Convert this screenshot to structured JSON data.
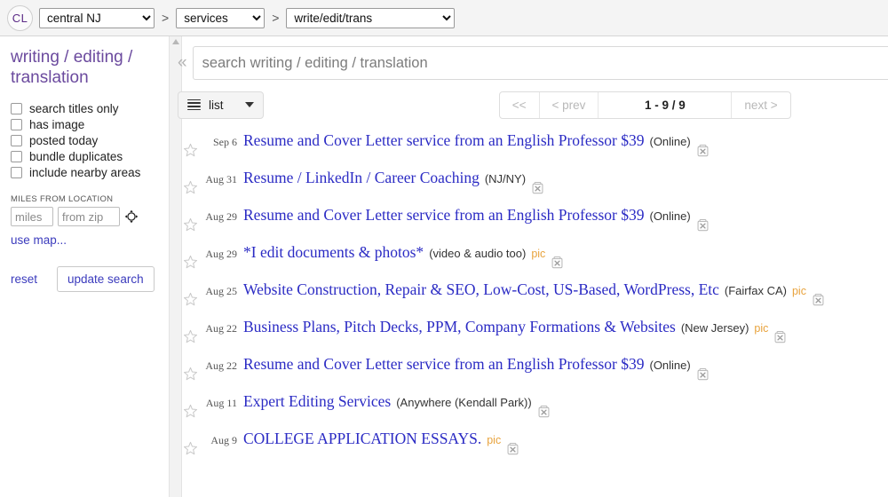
{
  "header": {
    "logo": "CL",
    "logo_icon": "cl-circle-icon",
    "separator": ">",
    "location": "central NJ",
    "category": "services",
    "subcategory": "write/edit/trans"
  },
  "sidebar": {
    "title": "writing / editing / translation",
    "checkboxes": [
      {
        "label": "search titles only",
        "checked": false
      },
      {
        "label": "has image",
        "checked": false
      },
      {
        "label": "posted today",
        "checked": false
      },
      {
        "label": "bundle duplicates",
        "checked": false
      },
      {
        "label": "include nearby areas",
        "checked": false
      }
    ],
    "miles_label": "MILES FROM LOCATION",
    "miles_placeholder": "miles",
    "zip_placeholder": "from zip",
    "miles_value": "",
    "zip_value": "",
    "crosshair_icon": "crosshair-target-icon",
    "use_map": "use map...",
    "reset": "reset",
    "update_search": "update search"
  },
  "main": {
    "collapse_icon": "«",
    "search_placeholder": "search writing / editing / translation",
    "search_value": "",
    "view_mode": "list",
    "view_icon": "hamburger-list-icon",
    "pager": {
      "first": "<<",
      "prev": "< prev",
      "count": "1 - 9 / 9",
      "next": "next >"
    }
  },
  "listings": [
    {
      "date": "Sep 6",
      "title": "Resume and Cover Letter service from an English Professor $39",
      "hood": "(Online)",
      "pic": ""
    },
    {
      "date": "Aug 31",
      "title": "Resume / LinkedIn / Career Coaching",
      "hood": "(NJ/NY)",
      "pic": ""
    },
    {
      "date": "Aug 29",
      "title": "Resume and Cover Letter service from an English Professor $39",
      "hood": "(Online)",
      "pic": ""
    },
    {
      "date": "Aug 29",
      "title": "*I edit documents & photos*",
      "hood": "(video & audio too)",
      "pic": "pic"
    },
    {
      "date": "Aug 25",
      "title": "Website Construction, Repair & SEO, Low-Cost, US-Based, WordPress, Etc",
      "hood": "(Fairfax CA)",
      "pic": "pic"
    },
    {
      "date": "Aug 22",
      "title": "Business Plans, Pitch Decks, PPM, Company Formations & Websites",
      "hood": "(New Jersey)",
      "pic": "pic"
    },
    {
      "date": "Aug 22",
      "title": "Resume and Cover Letter service from an English Professor $39",
      "hood": "(Online)",
      "pic": ""
    },
    {
      "date": "Aug 11",
      "title": "Expert Editing Services",
      "hood": "(Anywhere (Kendall Park))",
      "pic": ""
    },
    {
      "date": "Aug 9",
      "title": "COLLEGE APPLICATION ESSAYS.",
      "hood": "",
      "pic": "pic"
    }
  ],
  "colors": {
    "brand_purple": "#6b4a9e",
    "link_blue": "#2b2bc4",
    "pic_orange": "#e8a33d"
  }
}
